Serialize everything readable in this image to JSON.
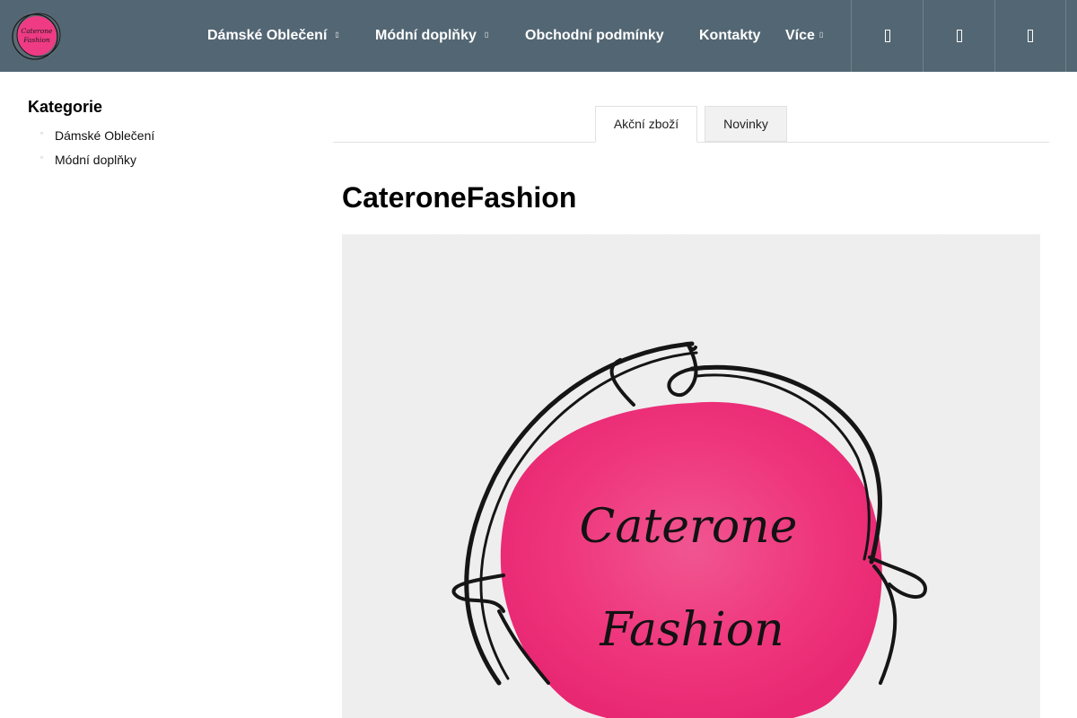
{
  "brand": {
    "logo_text_line1": "Caterone",
    "logo_text_line2": "Fashion"
  },
  "nav": {
    "items": [
      {
        "label": "Dámské Oblečení",
        "has_dropdown": true
      },
      {
        "label": "Módní doplňky",
        "has_dropdown": true
      },
      {
        "label": "Obchodní podmínky",
        "has_dropdown": false
      },
      {
        "label": "Kontakty",
        "has_dropdown": false
      },
      {
        "label": "Více",
        "has_dropdown": true
      }
    ],
    "caret": "▯",
    "icons": [
      "search-icon",
      "user-icon",
      "cart-icon"
    ]
  },
  "sidebar": {
    "title": "Kategorie",
    "bullet": "▫",
    "items": [
      {
        "label": "Dámské Oblečení"
      },
      {
        "label": "Módní doplňky"
      }
    ]
  },
  "tabs": [
    {
      "label": "Akční zboží",
      "active": true
    },
    {
      "label": "Novinky",
      "active": false
    }
  ],
  "main": {
    "title": "CateroneFashion",
    "hero_text_line1": "Caterone",
    "hero_text_line2": "Fashion"
  },
  "colors": {
    "header_bg": "#536673",
    "accent_pink": "#f0327a",
    "tab_inactive_bg": "#f1f1f1"
  }
}
